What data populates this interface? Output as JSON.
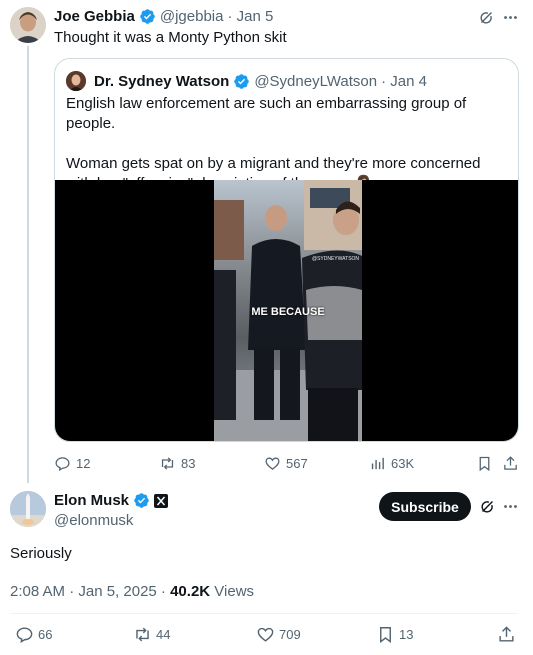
{
  "thread_tweet": {
    "name": "Joe Gebbia",
    "handle": "@jgebbia",
    "date": "· Jan 5",
    "text": "Thought it was a Monty Python skit",
    "quote": {
      "name": "Dr. Sydney Watson",
      "handle": "@SydneyLWatson",
      "date": "· Jan 4",
      "paragraph_1": "English law enforcement are such an embarrassing group of people.",
      "paragraph_2": "Woman gets spat on by a migrant and they're more concerned with her \"offensive\" description of the perp. 🤦‍♀️",
      "video_caption": "ME BECAUSE",
      "video_watermark": "@SYDNEYWATSON"
    },
    "actions": {
      "replies": "12",
      "reposts": "83",
      "likes": "567",
      "views": "63K"
    }
  },
  "main_tweet": {
    "name": "Elon Musk",
    "handle": "@elonmusk",
    "subscribe_label": "Subscribe",
    "text": "Seriously",
    "timestamp": "2:08 AM · Jan 5, 2025 · ",
    "view_count": "40.2K",
    "views_label": "Views",
    "actions": {
      "replies": "66",
      "reposts": "44",
      "likes": "709",
      "bookmarks": "13"
    }
  },
  "colors": {
    "verified_blue": "#1d9bf0",
    "muted_text": "#536471",
    "border": "#cfd9de"
  },
  "icons": [
    "verified-badge-icon",
    "grok-icon",
    "more-icon",
    "reply-icon",
    "repost-icon",
    "like-icon",
    "views-icon",
    "bookmark-icon",
    "share-icon",
    "x-affiliate-icon"
  ]
}
